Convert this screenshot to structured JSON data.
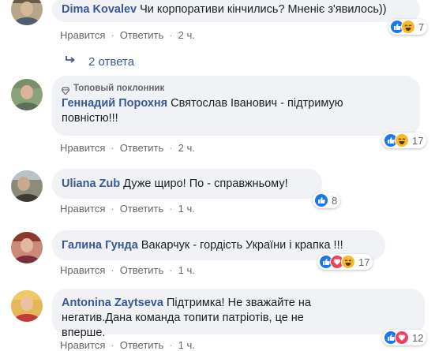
{
  "colors": {
    "link_blue": "#385898",
    "meta_gray": "#65676b",
    "bubble_bg": "#f0f2f5",
    "like_blue": "#1877f2",
    "haha_yellow": "#f7b928",
    "love_red": "#f33e58"
  },
  "actions": {
    "like": "Нравится",
    "reply": "Ответить",
    "separator": "·"
  },
  "replies_link": {
    "icon": "reply-arrow-icon",
    "label": "2 ответа"
  },
  "comments": [
    {
      "author": "Dima Kovalev",
      "text": "Чи корпоративи кінчились? Мненіє з'явилось))",
      "time": "2 ч.",
      "reactions": [
        "like",
        "haha"
      ],
      "reaction_count": "7"
    },
    {
      "badge": "Топовый поклонник",
      "author": "Геннадий Порохня",
      "text": "Святослав Іванович - підтримую повністю!!!",
      "time": "2 ч.",
      "reactions": [
        "like",
        "haha"
      ],
      "reaction_count": "17"
    },
    {
      "author": "Uliana Zub",
      "text": "Дуже щиро! По - справжньому!",
      "time": "1 ч.",
      "reactions": [
        "like"
      ],
      "reaction_count": "8"
    },
    {
      "author": "Галина Гунда",
      "text": "Вакарчук - гордість України і крапка !!!",
      "time": "1 ч.",
      "reactions": [
        "like",
        "love",
        "haha"
      ],
      "reaction_count": "17"
    },
    {
      "author": "Antonina Zaytseva",
      "text": "Підтримка! Не зважайте на негатив.Дана команда топити патріотів, це не вперше.",
      "time": "1 ч.",
      "reactions": [
        "like",
        "love"
      ],
      "reaction_count": "12"
    }
  ]
}
